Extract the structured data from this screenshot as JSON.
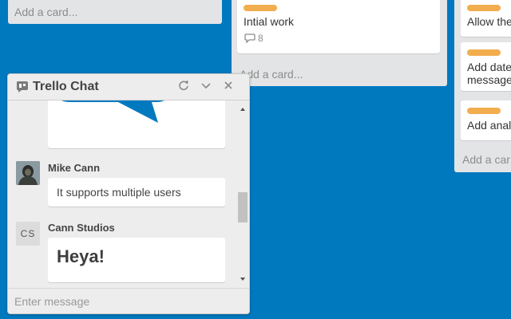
{
  "colors": {
    "board_background": "#0079bf",
    "list_background": "#e2e4e6",
    "label_orange": "#f2ad4e",
    "trello_logo_blue": "#0079bf"
  },
  "lists": [
    {
      "add_card_label": "Add a card..."
    },
    {
      "cards": [
        {
          "title": "Intial work",
          "label_color": "orange",
          "comment_count": "8"
        }
      ],
      "add_card_label": "Add a card..."
    },
    {
      "cards": [
        {
          "title": "Allow the",
          "label_color": "orange"
        },
        {
          "title": "Add date",
          "title_line2": "message",
          "label_color": "orange"
        },
        {
          "title": "Add anal",
          "label_color": "orange"
        }
      ],
      "add_card_label": "Add a car"
    }
  ],
  "chat": {
    "title": "Trello Chat",
    "header_icon": "chat-bubble-icon",
    "controls": [
      "refresh-icon",
      "chevron-down-icon",
      "close-icon"
    ],
    "messages": [
      {
        "author": "Mike Cann",
        "avatar": "photo",
        "text": "It supports multiple users"
      },
      {
        "author": "Cann Studios",
        "avatar_initials": "CS",
        "text": "Heya!"
      }
    ],
    "input_placeholder": "Enter message"
  }
}
